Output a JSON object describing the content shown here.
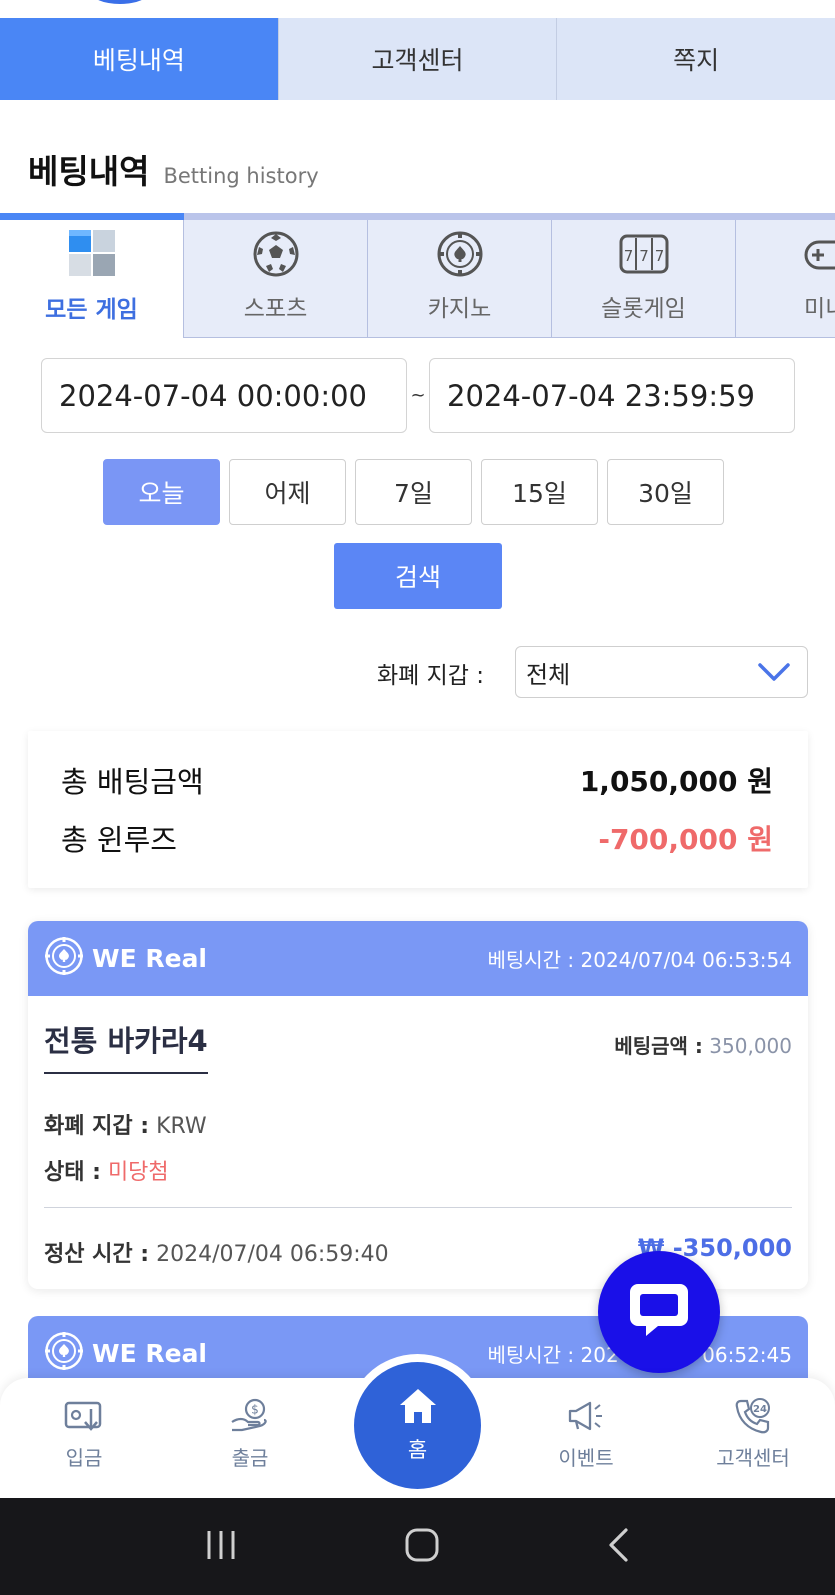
{
  "main_tabs": [
    {
      "label": "베팅내역",
      "active": true
    },
    {
      "label": "고객센터",
      "active": false
    },
    {
      "label": "쪽지",
      "active": false
    }
  ],
  "page_title": {
    "ko": "베팅내역",
    "en": "Betting history"
  },
  "categories": [
    {
      "label": "모든 게임",
      "icon": "all-games-cube-icon",
      "active": true
    },
    {
      "label": "스포츠",
      "icon": "soccer-ball-icon",
      "active": false
    },
    {
      "label": "카지노",
      "icon": "casino-chip-icon",
      "active": false
    },
    {
      "label": "슬롯게임",
      "icon": "slot-777-icon",
      "active": false
    },
    {
      "label": "미니",
      "icon": "gamepad-icon",
      "active": false
    }
  ],
  "date_range": {
    "start": "2024-07-04 00:00:00",
    "separator": "~",
    "end": "2024-07-04 23:59:59"
  },
  "quick_ranges": [
    {
      "label": "오늘",
      "active": true
    },
    {
      "label": "어제",
      "active": false
    },
    {
      "label": "7일",
      "active": false
    },
    {
      "label": "15일",
      "active": false
    },
    {
      "label": "30일",
      "active": false
    }
  ],
  "search_label": "검색",
  "currency_filter": {
    "label": "화폐 지갑 :",
    "selected": "전체"
  },
  "summary": {
    "total_bet_label": "총 배팅금액",
    "total_bet_value": "1,050,000 원",
    "total_winloss_label": "총 윈루즈",
    "total_winloss_value": "-700,000 원"
  },
  "bets": [
    {
      "provider": "WE Real",
      "bet_time_label": "베팅시간 :",
      "bet_time": "2024/07/04 06:53:54",
      "game": "전통 바카라4",
      "bet_amount_label": "베팅금액 :",
      "bet_amount": "350,000",
      "currency_label": "화폐 지갑 :",
      "currency": "KRW",
      "status_label": "상태 :",
      "status": "미당첨",
      "settle_label": "정산 시간 :",
      "settle_time": "2024/07/04 06:59:40",
      "result": "₩ -350,000"
    },
    {
      "provider": "WE Real",
      "bet_time_label": "베팅시간 :",
      "bet_time": "2024/07/04 06:52:45"
    }
  ],
  "bottom_nav": [
    {
      "label": "입금",
      "icon": "deposit-icon"
    },
    {
      "label": "출금",
      "icon": "withdraw-icon"
    },
    {
      "label": "홈",
      "icon": "home-icon"
    },
    {
      "label": "이벤트",
      "icon": "megaphone-icon"
    },
    {
      "label": "고객센터",
      "icon": "support-24-icon"
    }
  ],
  "colors": {
    "primary": "#4a86f5",
    "card_header": "#7a98f5",
    "negative": "#ef6a6a",
    "chat_button": "#1a10e8",
    "home_button": "#2f62d8"
  }
}
